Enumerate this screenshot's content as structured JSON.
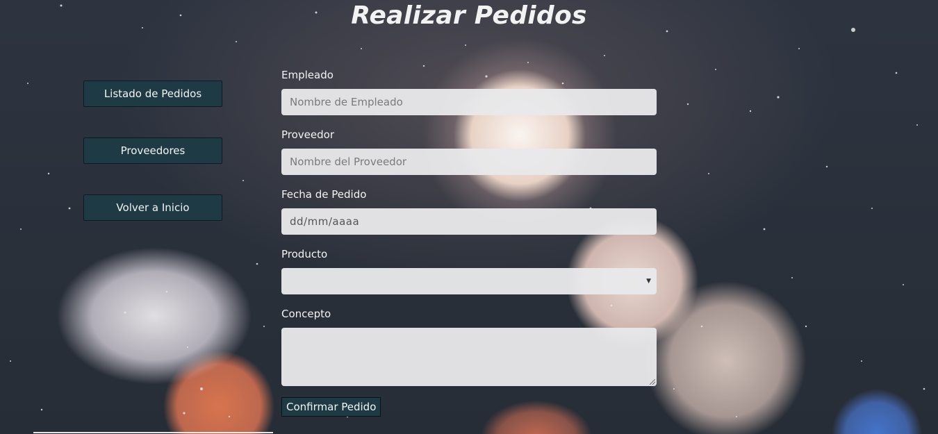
{
  "page": {
    "title": "Realizar Pedidos"
  },
  "nav": {
    "items": [
      {
        "label": "Listado de Pedidos"
      },
      {
        "label": "Proveedores"
      },
      {
        "label": "Volver a Inicio"
      }
    ]
  },
  "form": {
    "empleado": {
      "label": "Empleado",
      "placeholder": "Nombre de Empleado",
      "value": ""
    },
    "proveedor": {
      "label": "Proveedor",
      "placeholder": "Nombre del Proveedor",
      "value": ""
    },
    "fecha": {
      "label": "Fecha de Pedido",
      "value": "dd/mm/aaaa"
    },
    "producto": {
      "label": "Producto",
      "selected": ""
    },
    "concepto": {
      "label": "Concepto",
      "value": ""
    },
    "submit_label": "Confirmar Pedido"
  },
  "icons": {
    "select_arrow": "caret-down-icon"
  },
  "colors": {
    "button_bg": "#1e3a44",
    "field_bg": "#e8e8ea",
    "text": "#f3f3f3"
  }
}
